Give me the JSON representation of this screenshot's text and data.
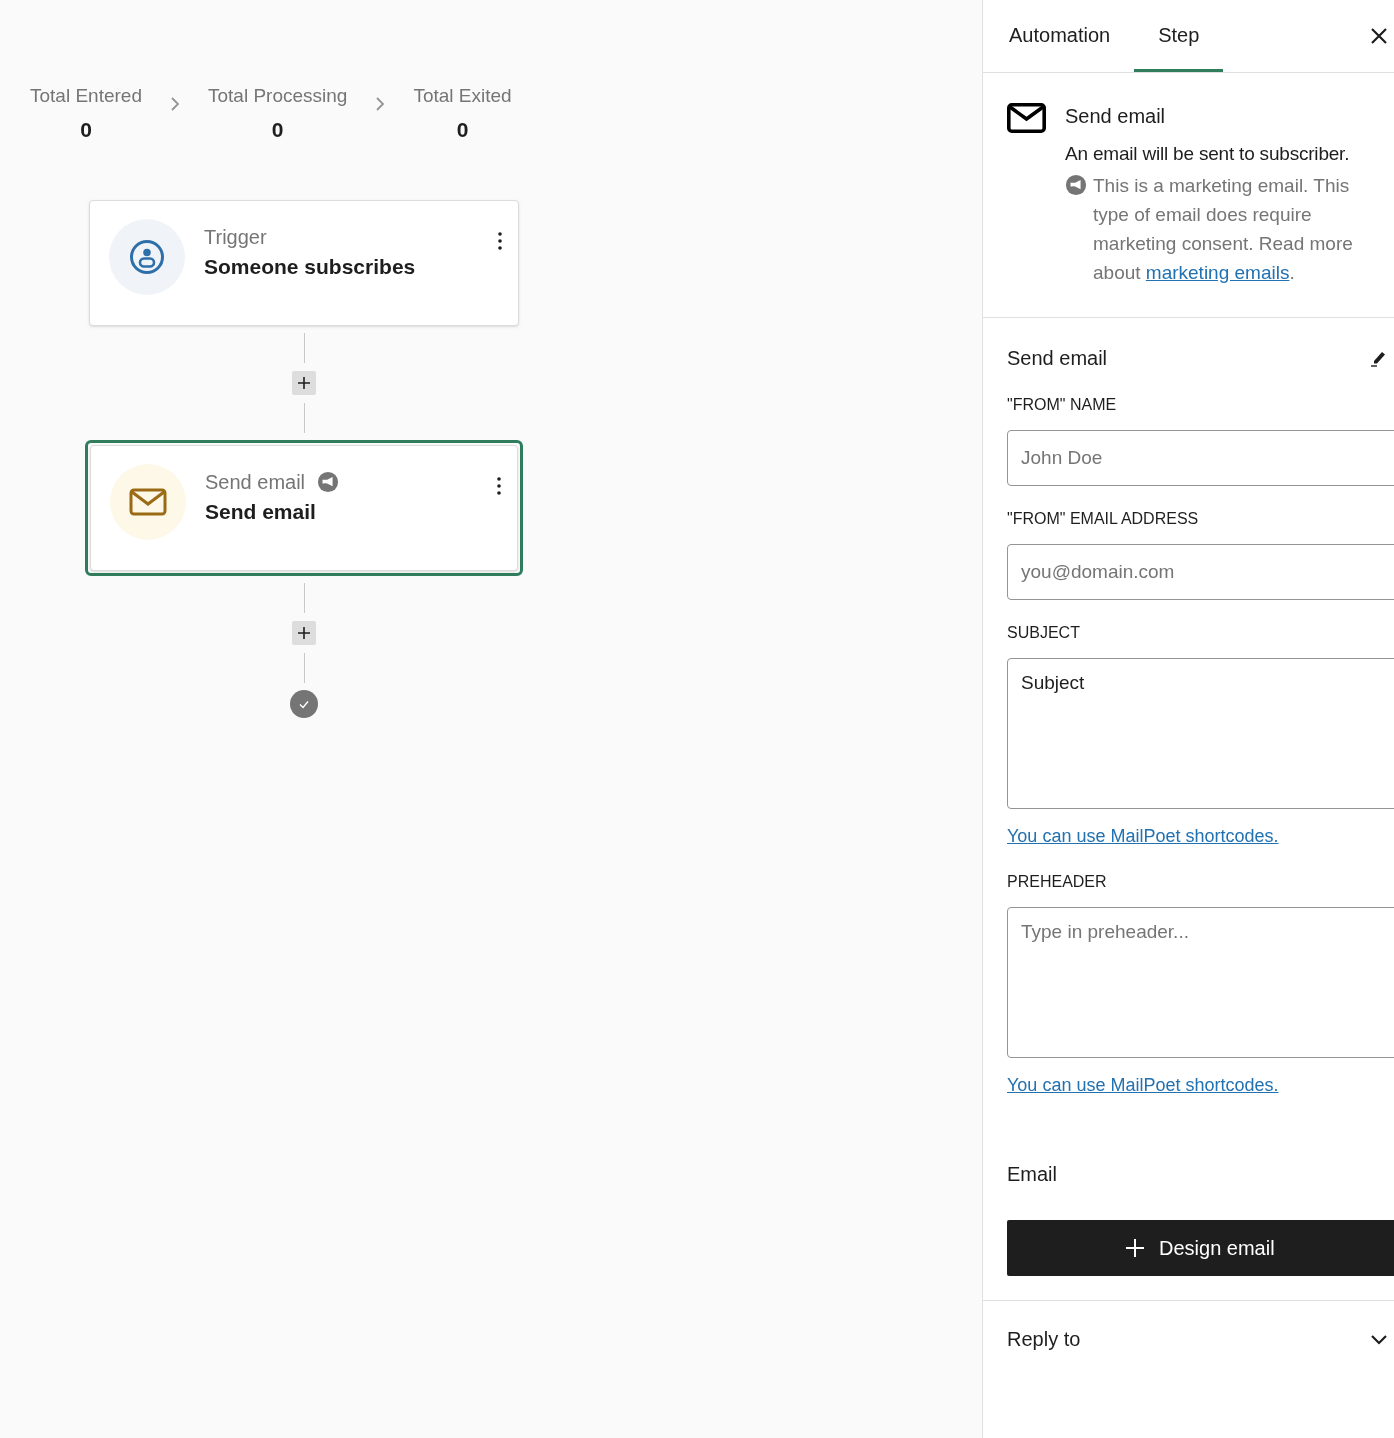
{
  "stats": [
    {
      "label": "Total Entered",
      "value": "0"
    },
    {
      "label": "Total Processing",
      "value": "0"
    },
    {
      "label": "Total Exited",
      "value": "0"
    }
  ],
  "steps": [
    {
      "kind": "trigger",
      "label": "Trigger",
      "title": "Someone subscribes",
      "selected": false,
      "marketing": false
    },
    {
      "kind": "email",
      "label": "Send email",
      "title": "Send email",
      "selected": true,
      "marketing": true
    }
  ],
  "panel": {
    "tabs": [
      {
        "label": "Automation",
        "selected": false
      },
      {
        "label": "Step",
        "selected": true
      }
    ],
    "step_title": "Send email",
    "description": "An email will be sent to subscriber.",
    "notice": "This is a marketing email. This type of email does require marketing consent. Read more about",
    "notice_link": "marketing emails",
    "notice_end": ".",
    "section": {
      "title": "Send email",
      "fields": [
        {
          "kind": "input",
          "label": "\"FROM\" NAME",
          "placeholder": "John Doe"
        },
        {
          "kind": "input",
          "label": "\"FROM\" EMAIL ADDRESS",
          "placeholder": "you@domain.com"
        },
        {
          "kind": "textarea",
          "label": "SUBJECT",
          "value": "Subject",
          "hint": "You can use MailPoet shortcodes."
        },
        {
          "kind": "textarea",
          "label": "PREHEADER",
          "placeholder": "Type in preheader...",
          "hint": "You can use MailPoet shortcodes."
        }
      ],
      "email_label": "Email",
      "design_button": "Design email"
    },
    "collapsibles": [
      {
        "title": "Reply to",
        "expanded": false
      }
    ]
  }
}
